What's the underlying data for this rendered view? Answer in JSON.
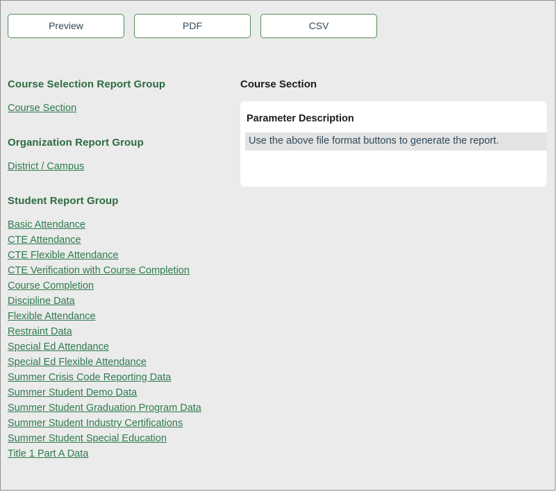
{
  "toolbar": {
    "buttons": [
      {
        "label": "Preview",
        "name": "preview-button"
      },
      {
        "label": "PDF",
        "name": "pdf-button"
      },
      {
        "label": "CSV",
        "name": "csv-button"
      }
    ]
  },
  "colors": {
    "page_background": "#ebebeb",
    "page_border": "#8d8d8d",
    "button_border": "#4e8a53",
    "button_text": "#2f4858",
    "group_heading": "#2c6b3f",
    "link": "#2e7a4e",
    "card_background": "#ffffff",
    "message_row_background": "#e3e3e3",
    "title_text": "#1b1b1b"
  },
  "left_column": {
    "groups": [
      {
        "heading": "Course Selection Report Group",
        "links": [
          "Course Section"
        ]
      },
      {
        "heading": "Organization Report Group",
        "links": [
          "District / Campus"
        ]
      },
      {
        "heading": "Student Report Group",
        "links": [
          "Basic Attendance",
          "CTE Attendance",
          "CTE Flexible Attendance",
          "CTE Verification with Course Completion",
          "Course Completion",
          "Discipline Data",
          "Flexible Attendance",
          "Restraint Data",
          "Special Ed Attendance",
          "Special Ed Flexible Attendance",
          "Summer Crisis Code Reporting Data",
          "Summer Student Demo Data",
          "Summer Student Graduation Program Data",
          "Summer Student Industry Certifications",
          "Summer Student Special Education",
          "Title 1 Part A Data"
        ]
      }
    ]
  },
  "right_column": {
    "section_title": "Course Section",
    "parameter_card": {
      "header": "Parameter Description",
      "message": "Use the above file format buttons to generate the report."
    }
  }
}
